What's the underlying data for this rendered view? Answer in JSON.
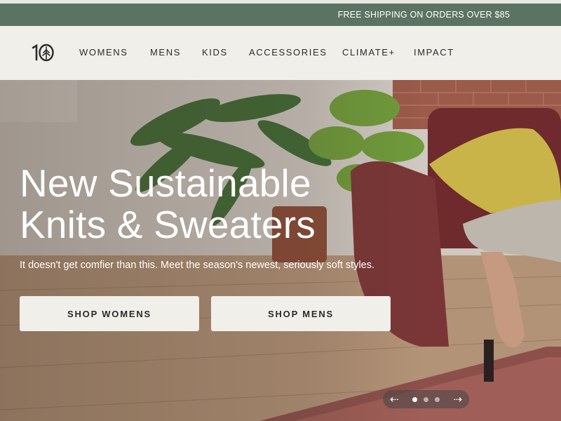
{
  "promo": {
    "text": "FREE SHIPPING ON ORDERS OVER $85"
  },
  "nav": {
    "logo_text": "10",
    "items": [
      {
        "label": "WOMENS"
      },
      {
        "label": "MENS"
      },
      {
        "label": "KIDS"
      },
      {
        "label": "ACCESSORIES"
      },
      {
        "label": "CLIMATE+"
      },
      {
        "label": "IMPACT"
      }
    ]
  },
  "hero": {
    "title_line1": "New Sustainable",
    "title_line2": "Knits & Sweaters",
    "subtitle": "It doesn't get comfier than this. Meet the season's newest, seriously soft styles.",
    "button_women": "SHOP WOMENS",
    "button_men": "SHOP MENS",
    "image_icon": "lifestyle-photo"
  },
  "carousel": {
    "prev_icon": "arrow-left-icon",
    "next_icon": "arrow-right-icon",
    "slide_count": 3,
    "active_slide": 1
  },
  "colors": {
    "promo_bg": "#5b7363",
    "nav_bg": "#f1efea",
    "button_bg": "#f1efea",
    "text_dark": "#2b2b2b"
  }
}
